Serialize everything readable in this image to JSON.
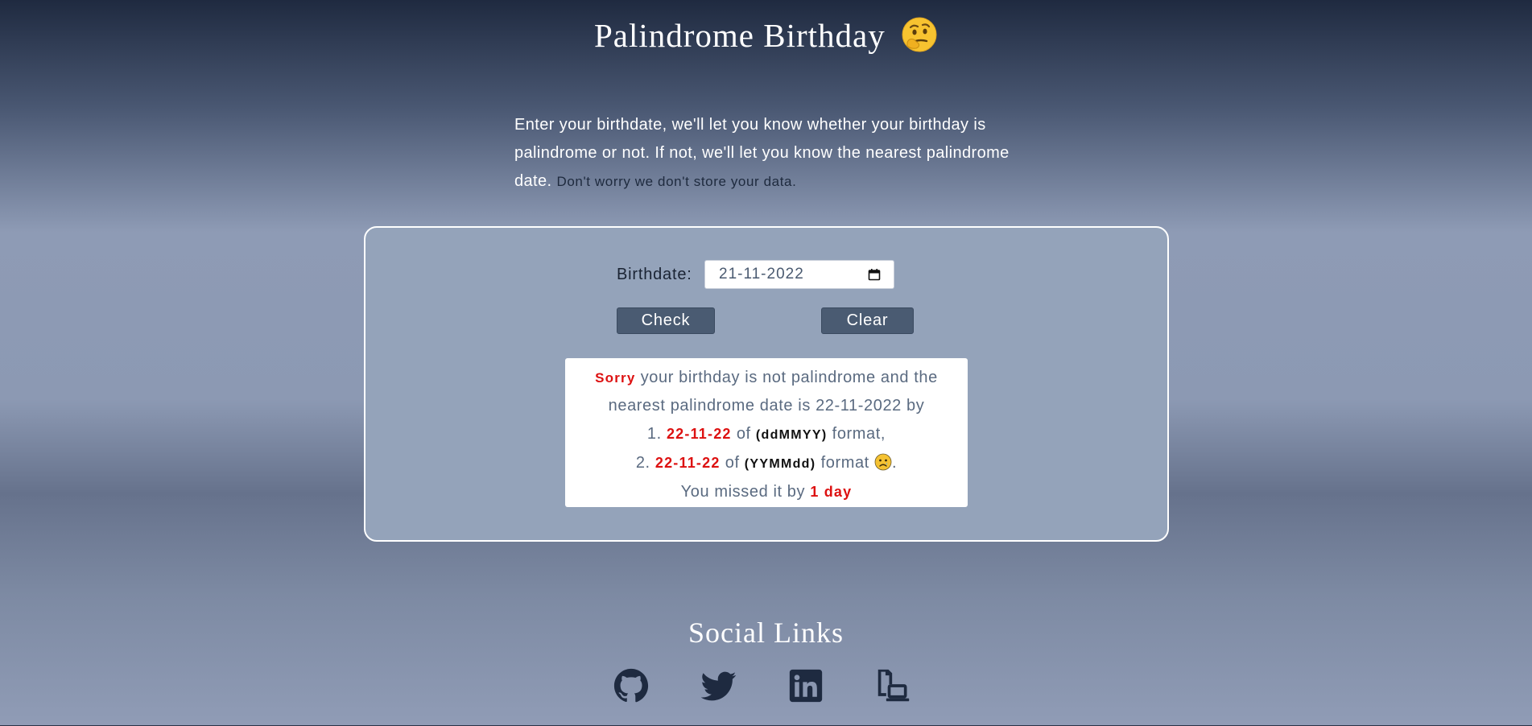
{
  "header": {
    "title": "Palindrome Birthday",
    "emoji": "thinking-face-icon"
  },
  "intro": {
    "text": "Enter your birthdate, we'll let you know whether your birthday is palindrome or not. If not, we'll let you know the nearest palindrome date.",
    "note": "Don't worry we don't store your data."
  },
  "form": {
    "birthdate_label": "Birthdate:",
    "birthdate_value": "21-11-2022",
    "check_label": "Check",
    "clear_label": "Clear"
  },
  "result": {
    "sorry": "Sorry",
    "line1_rest": "your birthday is not palindrome and the",
    "line2": "nearest palindrome date is 22-11-2022 by",
    "item1_num": "1.",
    "item1_date": "22-11-22",
    "of": "of",
    "item1_format": "(ddMMYY)",
    "item1_suffix": "format,",
    "item2_num": "2.",
    "item2_date": "22-11-22",
    "item2_format": "(YYMMdd)",
    "item2_suffix": "format",
    "item2_end": ".",
    "missed_prefix": "You missed it by",
    "missed_value": "1 day"
  },
  "social": {
    "title": "Social Links",
    "links": [
      "github-icon",
      "twitter-icon",
      "linkedin-icon",
      "portfolio-icon"
    ]
  },
  "colors": {
    "accent_red": "#dd1111",
    "button_bg": "#4a5b72",
    "card_bg": "#94a3ba",
    "social_icon": "#1e2a40"
  }
}
